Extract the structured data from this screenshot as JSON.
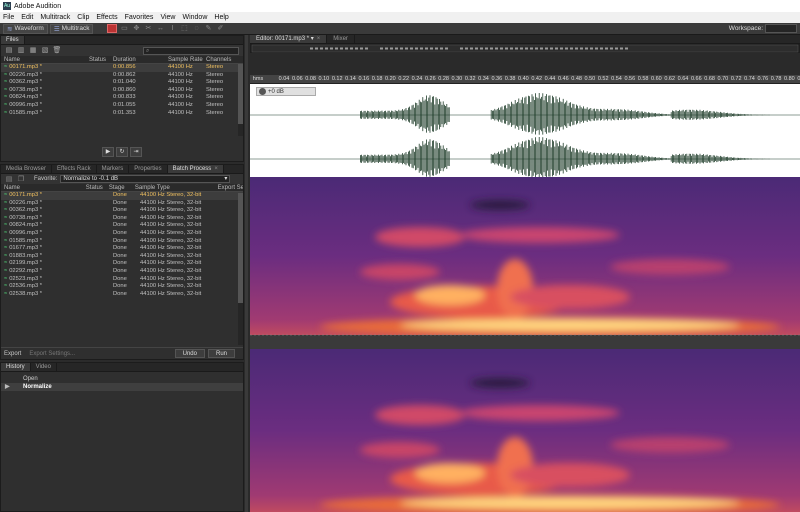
{
  "window": {
    "title": "Adobe Audition",
    "app_icon": "Au"
  },
  "menu": [
    "File",
    "Edit",
    "Multitrack",
    "Clip",
    "Effects",
    "Favorites",
    "View",
    "Window",
    "Help"
  ],
  "toolbar": {
    "waveform_label": "Waveform",
    "multitrack_label": "Multitrack",
    "workspace_label": "Workspace:"
  },
  "files_panel": {
    "tab": "Files",
    "columns": [
      "Name",
      "Status",
      "Duration",
      "Sample Rate",
      "Channels"
    ],
    "rows": [
      {
        "name": "00171.mp3 *",
        "status": "",
        "duration": "0:00.856",
        "rate": "44100 Hz",
        "channels": "Stereo"
      },
      {
        "name": "00226.mp3 *",
        "status": "",
        "duration": "0:00.862",
        "rate": "44100 Hz",
        "channels": "Stereo"
      },
      {
        "name": "00362.mp3 *",
        "status": "",
        "duration": "0:01.040",
        "rate": "44100 Hz",
        "channels": "Stereo"
      },
      {
        "name": "00738.mp3 *",
        "status": "",
        "duration": "0:00.860",
        "rate": "44100 Hz",
        "channels": "Stereo"
      },
      {
        "name": "00824.mp3 *",
        "status": "",
        "duration": "0:00.833",
        "rate": "44100 Hz",
        "channels": "Stereo"
      },
      {
        "name": "00996.mp3 *",
        "status": "",
        "duration": "0:01.055",
        "rate": "44100 Hz",
        "channels": "Stereo"
      },
      {
        "name": "01585.mp3 *",
        "status": "",
        "duration": "0:01.353",
        "rate": "44100 Hz",
        "channels": "Stereo"
      }
    ]
  },
  "batch_panel": {
    "tabs": [
      "Media Browser",
      "Effects Rack",
      "Markers",
      "Properties",
      "Batch Process"
    ],
    "active_tab": "Batch Process",
    "favorite_label": "Favorite:",
    "favorite_value": "Normalize to -0.1 dB",
    "columns": [
      "Name",
      "Status",
      "Stage",
      "Sample Type",
      "Export Se"
    ],
    "rows": [
      {
        "name": "00171.mp3 *",
        "stage": "Done",
        "type": "44100 Hz Stereo, 32-bit"
      },
      {
        "name": "00226.mp3 *",
        "stage": "Done",
        "type": "44100 Hz Stereo, 32-bit"
      },
      {
        "name": "00362.mp3 *",
        "stage": "Done",
        "type": "44100 Hz Stereo, 32-bit"
      },
      {
        "name": "00738.mp3 *",
        "stage": "Done",
        "type": "44100 Hz Stereo, 32-bit"
      },
      {
        "name": "00824.mp3 *",
        "stage": "Done",
        "type": "44100 Hz Stereo, 32-bit"
      },
      {
        "name": "00996.mp3 *",
        "stage": "Done",
        "type": "44100 Hz Stereo, 32-bit"
      },
      {
        "name": "01585.mp3 *",
        "stage": "Done",
        "type": "44100 Hz Stereo, 32-bit"
      },
      {
        "name": "01677.mp3 *",
        "stage": "Done",
        "type": "44100 Hz Stereo, 32-bit"
      },
      {
        "name": "01883.mp3 *",
        "stage": "Done",
        "type": "44100 Hz Stereo, 32-bit"
      },
      {
        "name": "02199.mp3 *",
        "stage": "Done",
        "type": "44100 Hz Stereo, 32-bit"
      },
      {
        "name": "02292.mp3 *",
        "stage": "Done",
        "type": "44100 Hz Stereo, 32-bit"
      },
      {
        "name": "02523.mp3 *",
        "stage": "Done",
        "type": "44100 Hz Stereo, 32-bit"
      },
      {
        "name": "02536.mp3 *",
        "stage": "Done",
        "type": "44100 Hz Stereo, 32-bit"
      },
      {
        "name": "02538.mp3 *",
        "stage": "Done",
        "type": "44100 Hz Stereo, 32-bit"
      }
    ],
    "export_label": "Export",
    "export_settings_label": "Export Settings...",
    "undo_label": "Undo",
    "run_label": "Run"
  },
  "history_panel": {
    "tabs": [
      "History",
      "Video"
    ],
    "items": [
      "Open",
      "Normalize"
    ],
    "selected": "Normalize"
  },
  "editor": {
    "tabs": [
      "Editor: 00171.mp3 *",
      "Mixer"
    ],
    "ruler_unit": "hms",
    "ruler_ticks": [
      "0.04",
      "0.06",
      "0.08",
      "0.10",
      "0.12",
      "0.14",
      "0.16",
      "0.18",
      "0.20",
      "0.22",
      "0.24",
      "0.26",
      "0.28",
      "0.30",
      "0.32",
      "0.34",
      "0.36",
      "0.38",
      "0.40",
      "0.42",
      "0.44",
      "0.46",
      "0.48",
      "0.50",
      "0.52",
      "0.54",
      "0.56",
      "0.58",
      "0.60",
      "0.62",
      "0.64",
      "0.66",
      "0.68",
      "0.70",
      "0.72",
      "0.74",
      "0.76",
      "0.78",
      "0.80",
      "0.82"
    ],
    "volume_label": "+0 dB"
  },
  "colors": {
    "accent": "#f0c060",
    "waveform": "#1f3d2a",
    "selected_row": "#3d3d3d"
  }
}
